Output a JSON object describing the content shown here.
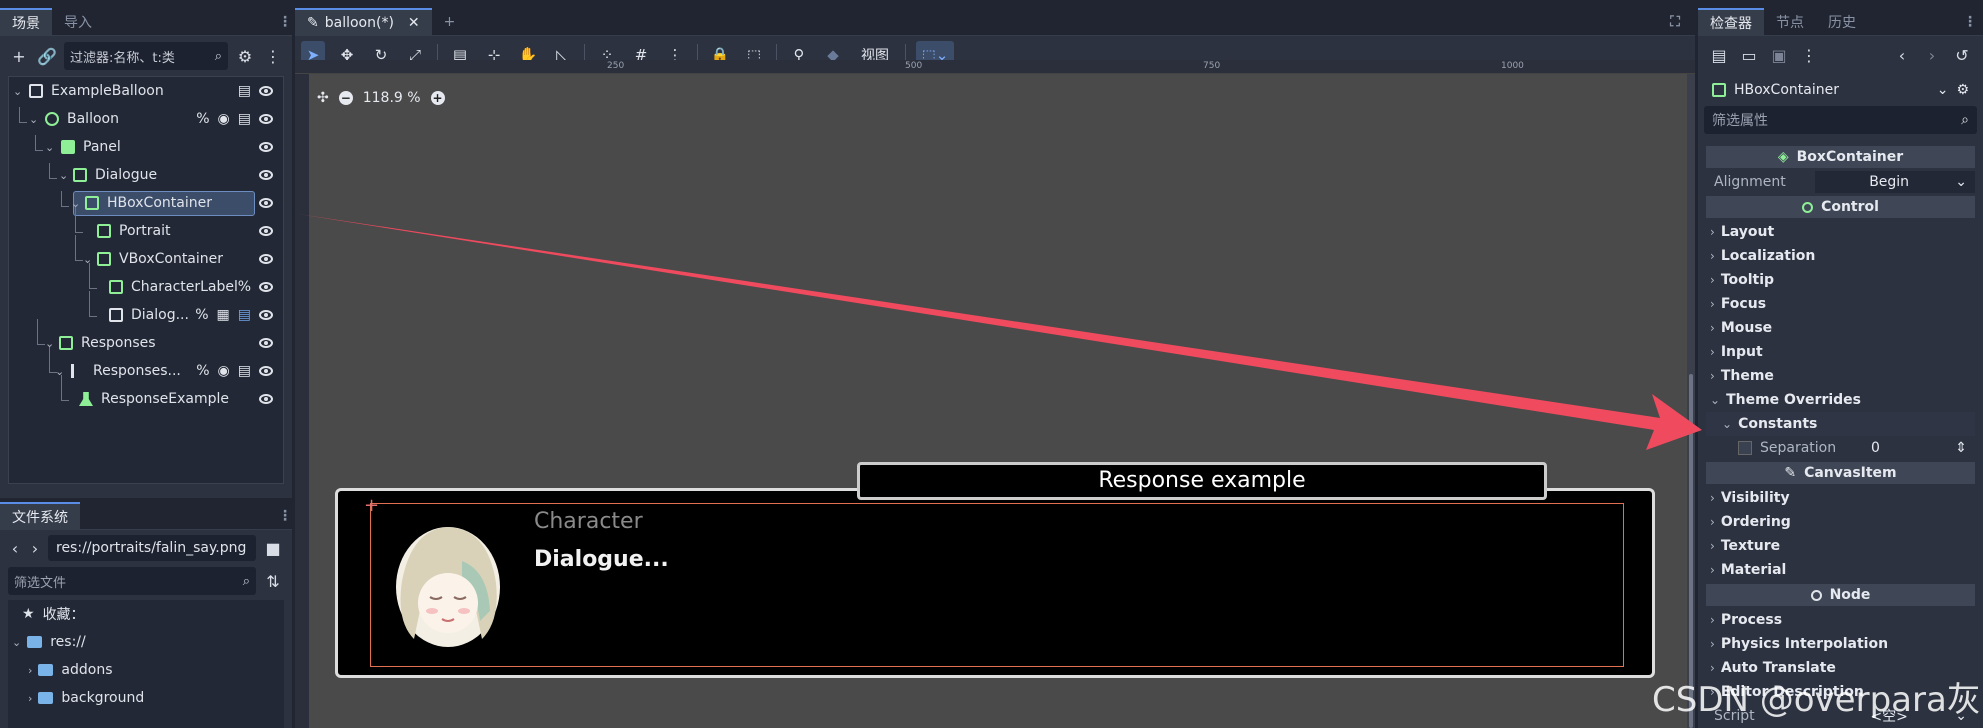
{
  "scene_dock": {
    "tabs": [
      "场景",
      "导入"
    ],
    "filter_placeholder": "过滤器:名称、t:类",
    "tree": [
      {
        "name": "ExampleBalloon",
        "icon": "scene-root-icon"
      },
      {
        "name": "Balloon",
        "icon": "canvas-layer-icon"
      },
      {
        "name": "Panel",
        "icon": "panel-icon"
      },
      {
        "name": "Dialogue",
        "icon": "margin-container-icon"
      },
      {
        "name": "HBoxContainer",
        "icon": "hbox-icon"
      },
      {
        "name": "Portrait",
        "icon": "texture-rect-icon"
      },
      {
        "name": "VBoxContainer",
        "icon": "vbox-icon"
      },
      {
        "name": "CharacterLabel",
        "icon": "rich-text-icon"
      },
      {
        "name": "Dialog...",
        "icon": "dialogue-label-icon"
      },
      {
        "name": "Responses",
        "icon": "margin-container-icon"
      },
      {
        "name": "Responses...",
        "icon": "responses-menu-icon"
      },
      {
        "name": "ResponseExample",
        "icon": "button-icon"
      }
    ],
    "badges": {
      "percent": "%"
    }
  },
  "fs_dock": {
    "title": "文件系统",
    "path": "res://portraits/falin_say.png",
    "filter_placeholder": "筛选文件",
    "favorites": "收藏：",
    "items": [
      "res://",
      "addons",
      "background"
    ]
  },
  "viewport": {
    "tab_label": "balloon(*)",
    "view_label": "视图",
    "zoom": "118.9 %",
    "ruler_ticks": [
      "250",
      "500",
      "750",
      "1000"
    ],
    "character": "Character",
    "dialogue": "Dialogue...",
    "response_example": "Response example"
  },
  "inspector": {
    "tabs": [
      "检查器",
      "节点",
      "历史"
    ],
    "node_name": "HBoxContainer",
    "filter_placeholder": "筛选属性",
    "sections": {
      "box": "BoxContainer",
      "control": "Control",
      "canvas": "CanvasItem",
      "node": "Node"
    },
    "alignment_label": "Alignment",
    "alignment_value": "Begin",
    "control_groups": [
      "Layout",
      "Localization",
      "Tooltip",
      "Focus",
      "Mouse",
      "Input",
      "Theme",
      "Theme Overrides"
    ],
    "constants": "Constants",
    "separation_label": "Separation",
    "separation_value": "0",
    "canvas_groups": [
      "Visibility",
      "Ordering",
      "Texture",
      "Material"
    ],
    "node_groups": [
      "Process",
      "Physics Interpolation",
      "Auto Translate",
      "Editor Description"
    ],
    "script_label": "Script",
    "script_value": "<空>"
  },
  "watermark": "CSDN @overpara灰",
  "colors": {
    "accent": "#5a8de6",
    "node_green": "#8eef97",
    "arrow": "#f04a5e"
  }
}
